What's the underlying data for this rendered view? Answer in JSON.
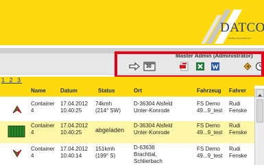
{
  "brand": {
    "logo_text": "DATCOM",
    "logo_tagline": "MOBILE INFORMATION"
  },
  "user": {
    "label": "Master Admin (Administrator)"
  },
  "toolbar": {
    "icons": [
      "arrow-right-icon",
      "calendar-icon",
      "pdf-export-icon",
      "excel-export-icon",
      "word-export-icon",
      "refresh-icon",
      "clock-icon"
    ],
    "calendar_label": "30"
  },
  "pager": {
    "pages": "1 2 3"
  },
  "table": {
    "columns": [
      "Name",
      "Datum",
      "Status",
      "Ort",
      "Fahrzeug",
      "Fahrer"
    ],
    "rows": [
      {
        "icon": "vehicle-heading-icon",
        "name": "Container\n4",
        "date": "17.04.2012\n10:40:25",
        "status": "74kmh\n(214° SW)",
        "location": "D-36304 Alsfeld\nUnter-Konrode",
        "vehicle": "FS Demo\n49...9_test",
        "driver": "Rudi\nFenske",
        "highlighted": false
      },
      {
        "icon": "container-icon",
        "name": "Container\n4",
        "date": "17.04.2012\n10:40:25",
        "status": "abgeladen",
        "location": "D-36304 Alsfeld\nUnter-Konrode",
        "vehicle": "FS Demo\n49...9_test",
        "driver": "Rudi\nFenske",
        "highlighted": true
      },
      {
        "icon": "vehicle-heading-icon",
        "name": "Container\n4",
        "date": "17.04.2012\n10:40:14",
        "status": "151kmh\n(199° S)",
        "location": "D-63636\nBrachttal,\nSchlierbach",
        "vehicle": "FS Demo\n49...9_test",
        "driver": "Rudi\nFenske",
        "highlighted": false
      }
    ]
  },
  "colors": {
    "brand_yellow": "#fdd90d",
    "highlight_red": "#e5001a",
    "row_highlight": "#fff7a8",
    "header_text": "#1d2b5c"
  }
}
